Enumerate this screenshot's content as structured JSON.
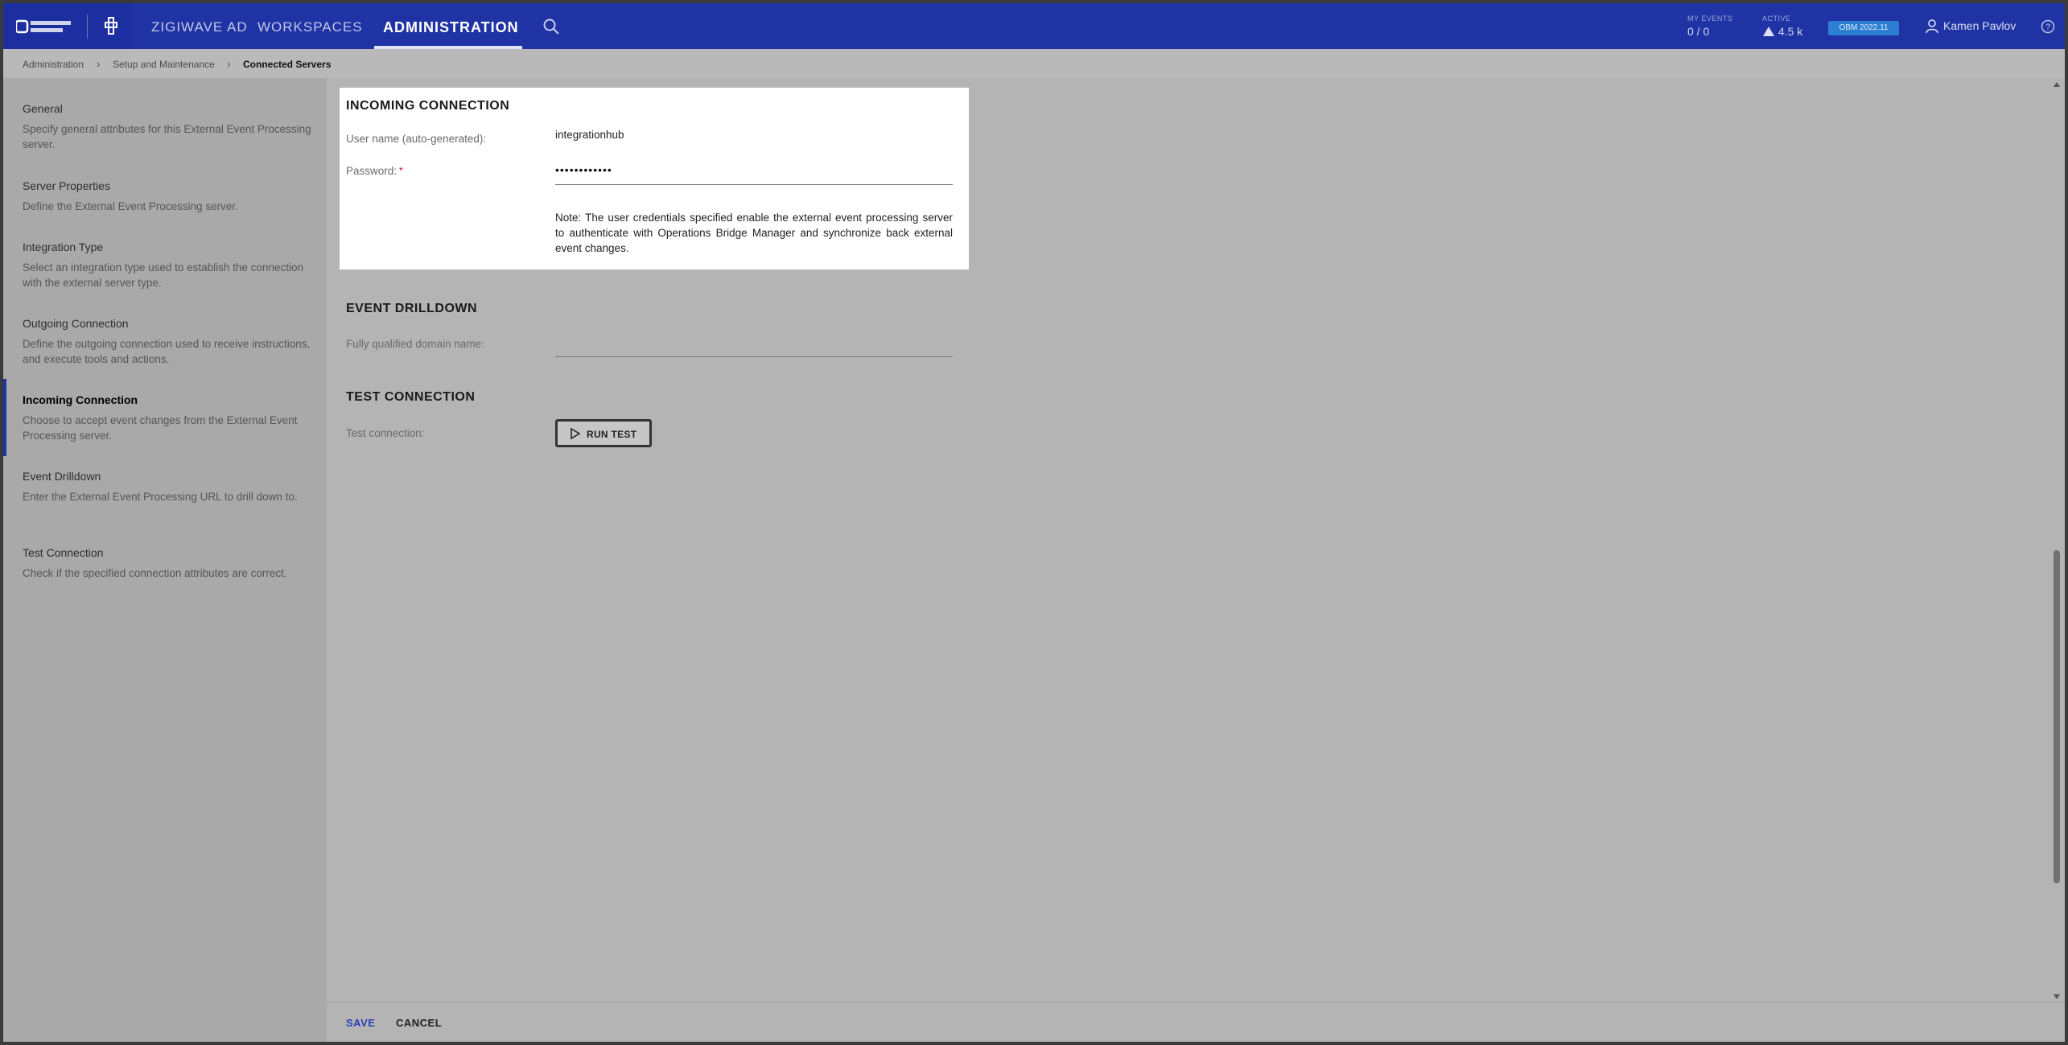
{
  "topbar": {
    "nav": [
      "ZIGIWAVE AD",
      "WORKSPACES",
      "ADMINISTRATION"
    ],
    "my_events_label": "MY EVENTS",
    "my_events_value": "0 / 0",
    "active_label": "ACTIVE",
    "active_value": "4.5 k",
    "version": "OBM 2022.11",
    "user": "Kamen Pavlov",
    "brand_color": "#1f33a5"
  },
  "breadcrumb": [
    "Administration",
    "Setup and Maintenance",
    "Connected Servers"
  ],
  "sidebar": {
    "items": [
      {
        "title": "General",
        "desc": "Specify general attributes for this External Event Processing server."
      },
      {
        "title": "Server Properties",
        "desc": "Define the External Event Processing server."
      },
      {
        "title": "Integration Type",
        "desc": "Select an integration type used to establish the connection with the external server type."
      },
      {
        "title": "Outgoing Connection",
        "desc": "Define the outgoing connection used to receive instructions, and execute tools and actions."
      },
      {
        "title": "Incoming Connection",
        "desc": "Choose to accept event changes from the External Event Processing server."
      },
      {
        "title": "Event Drilldown",
        "desc": "Enter the External Event Processing URL to drill down to."
      },
      {
        "title": "Test Connection",
        "desc": "Check if the specified connection attributes are correct."
      }
    ],
    "active_index": 4
  },
  "incoming": {
    "title": "INCOMING CONNECTION",
    "username_label": "User name (auto-generated):",
    "username_value": "integrationhub",
    "password_label": "Password:",
    "password_value": "••••••••••••",
    "required_mark": "*",
    "note": "Note: The user credentials specified enable the external event processing server to authenticate with Operations Bridge Manager and synchronize back external event changes."
  },
  "drilldown": {
    "title": "EVENT DRILLDOWN",
    "fqdn_label": "Fully qualified domain name:",
    "fqdn_value": ""
  },
  "test": {
    "title": "TEST CONNECTION",
    "label": "Test connection:",
    "button": "RUN TEST"
  },
  "footer": {
    "save": "SAVE",
    "cancel": "CANCEL"
  }
}
